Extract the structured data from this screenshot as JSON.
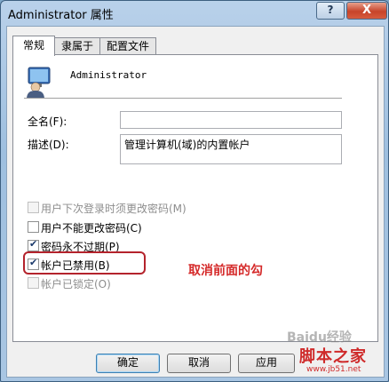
{
  "window": {
    "title": "Administrator 属性"
  },
  "titlebar": {
    "help_glyph": "?",
    "close_glyph": "X"
  },
  "tabs": [
    {
      "label": "常规",
      "active": true
    },
    {
      "label": "隶属于",
      "active": false
    },
    {
      "label": "配置文件",
      "active": false
    }
  ],
  "general": {
    "username": "Administrator",
    "fullname_label": "全名(F):",
    "fullname_value": "",
    "description_label": "描述(D):",
    "description_value": "管理计算机(域)的内置帐户"
  },
  "options": [
    {
      "label": "用户下次登录时须更改密码(M)",
      "checked": false,
      "enabled": false
    },
    {
      "label": "用户不能更改密码(C)",
      "checked": false,
      "enabled": true
    },
    {
      "label": "密码永不过期(P)",
      "checked": true,
      "enabled": true
    },
    {
      "label": "帐户已禁用(B)",
      "checked": true,
      "enabled": true
    },
    {
      "label": "帐户已锁定(O)",
      "checked": false,
      "enabled": false
    }
  ],
  "annotation": {
    "text": "取消前面的勾",
    "color": "#d52a2a"
  },
  "buttons": {
    "ok": "确定",
    "cancel": "取消",
    "apply": "应用"
  },
  "watermarks": {
    "baidu": "Baidu经验",
    "jb51": "脚本之家",
    "url": "www.jb51.net"
  },
  "icons": {
    "user": "user-icon",
    "check": "checkmark-icon",
    "help": "help-icon",
    "close": "close-icon"
  }
}
